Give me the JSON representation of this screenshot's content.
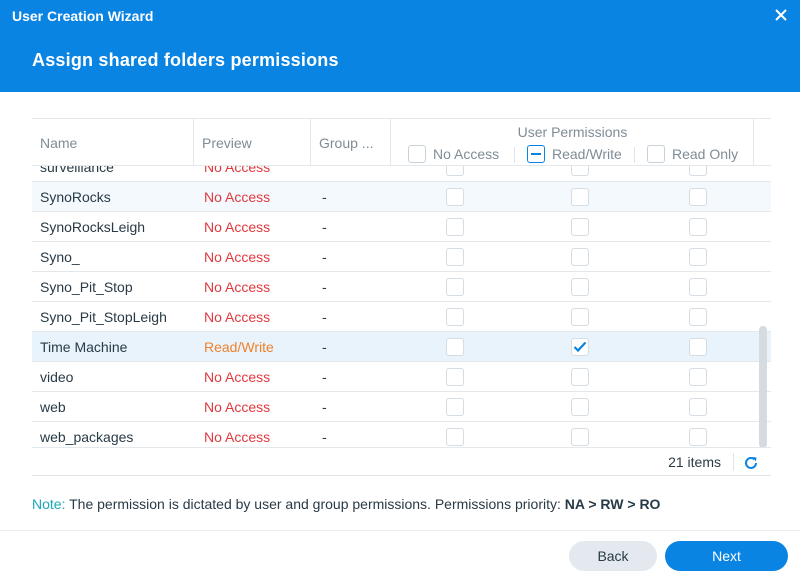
{
  "window": {
    "title": "User Creation Wizard",
    "page_title": "Assign shared folders permissions"
  },
  "table": {
    "columns": {
      "name": "Name",
      "preview": "Preview",
      "group": "Group ...",
      "user_permissions": "User Permissions"
    },
    "permission_options": [
      {
        "label": "No Access",
        "state": "unchecked"
      },
      {
        "label": "Read/Write",
        "state": "indeterminate"
      },
      {
        "label": "Read Only",
        "state": "unchecked"
      }
    ],
    "partial_top_row": {
      "name": "surveillance",
      "preview": "No Access"
    },
    "rows": [
      {
        "name": "SynoRocks",
        "preview": "No Access",
        "group": "-",
        "no_access": false,
        "read_write": false,
        "read_only": false
      },
      {
        "name": "SynoRocksLeigh",
        "preview": "No Access",
        "group": "-",
        "no_access": false,
        "read_write": false,
        "read_only": false
      },
      {
        "name": "Syno_",
        "preview": "No Access",
        "group": "-",
        "no_access": false,
        "read_write": false,
        "read_only": false
      },
      {
        "name": "Syno_Pit_Stop",
        "preview": "No Access",
        "group": "-",
        "no_access": false,
        "read_write": false,
        "read_only": false
      },
      {
        "name": "Syno_Pit_StopLeigh",
        "preview": "No Access",
        "group": "-",
        "no_access": false,
        "read_write": false,
        "read_only": false
      },
      {
        "name": "Time Machine",
        "preview": "Read/Write",
        "group": "-",
        "no_access": false,
        "read_write": true,
        "read_only": false
      },
      {
        "name": "video",
        "preview": "No Access",
        "group": "-",
        "no_access": false,
        "read_write": false,
        "read_only": false
      },
      {
        "name": "web",
        "preview": "No Access",
        "group": "-",
        "no_access": false,
        "read_write": false,
        "read_only": false
      },
      {
        "name": "web_packages",
        "preview": "No Access",
        "group": "-",
        "no_access": false,
        "read_write": false,
        "read_only": false
      }
    ],
    "item_count": "21 items"
  },
  "note": {
    "label": "Note:",
    "text": "The permission is dictated by user and group permissions. Permissions priority:",
    "priority": "NA > RW > RO"
  },
  "buttons": {
    "back": "Back",
    "next": "Next"
  },
  "icons": {
    "close": "close-icon",
    "refresh": "refresh-icon",
    "check": "checkmark-icon"
  },
  "colors": {
    "accent": "#0a84e3",
    "no_access": "#e0393e",
    "read_write": "#f0812a",
    "note_label": "#1aa8b5"
  }
}
